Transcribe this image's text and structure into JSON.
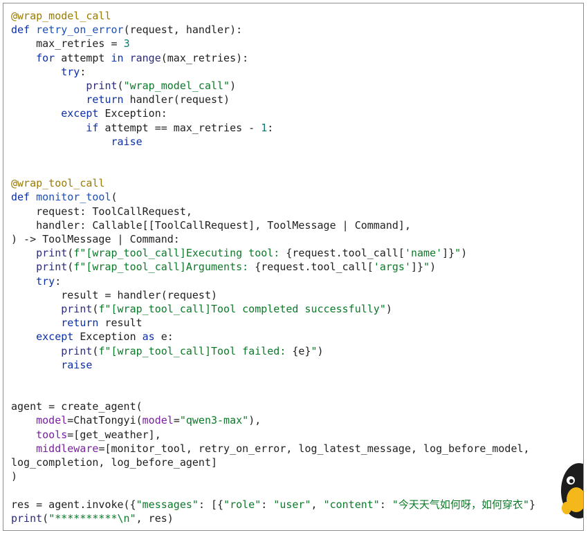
{
  "code_lines": [
    [
      {
        "t": "@wrap_model_call",
        "c": "dec"
      }
    ],
    [
      {
        "t": "def ",
        "c": "kw"
      },
      {
        "t": "retry_on_error",
        "c": "fn"
      },
      {
        "t": "(request, handler):",
        "c": "op"
      }
    ],
    [
      {
        "t": "    max_retries = ",
        "c": "op"
      },
      {
        "t": "3",
        "c": "num"
      }
    ],
    [
      {
        "t": "    ",
        "c": "op"
      },
      {
        "t": "for",
        "c": "kw"
      },
      {
        "t": " attempt ",
        "c": "op"
      },
      {
        "t": "in",
        "c": "kw"
      },
      {
        "t": " ",
        "c": "op"
      },
      {
        "t": "range",
        "c": "bi"
      },
      {
        "t": "(max_retries):",
        "c": "op"
      }
    ],
    [
      {
        "t": "        ",
        "c": "op"
      },
      {
        "t": "try",
        "c": "kw"
      },
      {
        "t": ":",
        "c": "op"
      }
    ],
    [
      {
        "t": "            ",
        "c": "op"
      },
      {
        "t": "print",
        "c": "bi"
      },
      {
        "t": "(",
        "c": "op"
      },
      {
        "t": "\"wrap_model_call\"",
        "c": "str"
      },
      {
        "t": ")",
        "c": "op"
      }
    ],
    [
      {
        "t": "            ",
        "c": "op"
      },
      {
        "t": "return",
        "c": "kw"
      },
      {
        "t": " handler(request)",
        "c": "op"
      }
    ],
    [
      {
        "t": "        ",
        "c": "op"
      },
      {
        "t": "except",
        "c": "kw"
      },
      {
        "t": " Exception:",
        "c": "op"
      }
    ],
    [
      {
        "t": "            ",
        "c": "op"
      },
      {
        "t": "if",
        "c": "kw"
      },
      {
        "t": " attempt == max_retries - ",
        "c": "op"
      },
      {
        "t": "1",
        "c": "num"
      },
      {
        "t": ":",
        "c": "op"
      }
    ],
    [
      {
        "t": "                ",
        "c": "op"
      },
      {
        "t": "raise",
        "c": "kw"
      }
    ],
    [],
    [],
    [
      {
        "t": "@wrap_tool_call",
        "c": "dec"
      }
    ],
    [
      {
        "t": "def ",
        "c": "kw"
      },
      {
        "t": "monitor_tool",
        "c": "fn"
      },
      {
        "t": "(",
        "c": "op"
      }
    ],
    [
      {
        "t": "    request: ToolCallRequest,",
        "c": "op"
      }
    ],
    [
      {
        "t": "    handler: Callable[[ToolCallRequest], ToolMessage | Command],",
        "c": "op"
      }
    ],
    [
      {
        "t": ") -> ToolMessage | Command:",
        "c": "op"
      }
    ],
    [
      {
        "t": "    ",
        "c": "op"
      },
      {
        "t": "print",
        "c": "bi"
      },
      {
        "t": "(",
        "c": "op"
      },
      {
        "t": "f\"[wrap_tool_call]Executing tool: ",
        "c": "str"
      },
      {
        "t": "{request.tool_call[",
        "c": "op"
      },
      {
        "t": "'name'",
        "c": "str"
      },
      {
        "t": "]}",
        "c": "op"
      },
      {
        "t": "\"",
        "c": "str"
      },
      {
        "t": ")",
        "c": "op"
      }
    ],
    [
      {
        "t": "    ",
        "c": "op"
      },
      {
        "t": "print",
        "c": "bi"
      },
      {
        "t": "(",
        "c": "op"
      },
      {
        "t": "f\"[wrap_tool_call]Arguments: ",
        "c": "str"
      },
      {
        "t": "{request.tool_call[",
        "c": "op"
      },
      {
        "t": "'args'",
        "c": "str"
      },
      {
        "t": "]}",
        "c": "op"
      },
      {
        "t": "\"",
        "c": "str"
      },
      {
        "t": ")",
        "c": "op"
      }
    ],
    [
      {
        "t": "    ",
        "c": "op"
      },
      {
        "t": "try",
        "c": "kw"
      },
      {
        "t": ":",
        "c": "op"
      }
    ],
    [
      {
        "t": "        result = handler(request)",
        "c": "op"
      }
    ],
    [
      {
        "t": "        ",
        "c": "op"
      },
      {
        "t": "print",
        "c": "bi"
      },
      {
        "t": "(",
        "c": "op"
      },
      {
        "t": "f\"[wrap_tool_call]Tool completed successfully\"",
        "c": "str"
      },
      {
        "t": ")",
        "c": "op"
      }
    ],
    [
      {
        "t": "        ",
        "c": "op"
      },
      {
        "t": "return",
        "c": "kw"
      },
      {
        "t": " result",
        "c": "op"
      }
    ],
    [
      {
        "t": "    ",
        "c": "op"
      },
      {
        "t": "except",
        "c": "kw"
      },
      {
        "t": " Exception ",
        "c": "op"
      },
      {
        "t": "as",
        "c": "kw"
      },
      {
        "t": " e:",
        "c": "op"
      }
    ],
    [
      {
        "t": "        ",
        "c": "op"
      },
      {
        "t": "print",
        "c": "bi"
      },
      {
        "t": "(",
        "c": "op"
      },
      {
        "t": "f\"[wrap_tool_call]Tool failed: ",
        "c": "str"
      },
      {
        "t": "{e}",
        "c": "op"
      },
      {
        "t": "\"",
        "c": "str"
      },
      {
        "t": ")",
        "c": "op"
      }
    ],
    [
      {
        "t": "        ",
        "c": "op"
      },
      {
        "t": "raise",
        "c": "kw"
      }
    ],
    [],
    [],
    [
      {
        "t": "agent = create_agent(",
        "c": "op"
      }
    ],
    [
      {
        "t": "    ",
        "c": "op"
      },
      {
        "t": "model",
        "c": "par"
      },
      {
        "t": "=ChatTongyi(",
        "c": "op"
      },
      {
        "t": "model",
        "c": "par"
      },
      {
        "t": "=",
        "c": "op"
      },
      {
        "t": "\"qwen3-max\"",
        "c": "str"
      },
      {
        "t": "),",
        "c": "op"
      }
    ],
    [
      {
        "t": "    ",
        "c": "op"
      },
      {
        "t": "tools",
        "c": "par"
      },
      {
        "t": "=[get_weather],",
        "c": "op"
      }
    ],
    [
      {
        "t": "    ",
        "c": "op"
      },
      {
        "t": "middleware",
        "c": "par"
      },
      {
        "t": "=[monitor_tool, retry_on_error, log_latest_message, log_before_model,",
        "c": "op"
      }
    ],
    [
      {
        "t": "log_completion, log_before_agent]",
        "c": "op"
      }
    ],
    [
      {
        "t": ")",
        "c": "op"
      }
    ],
    [],
    [
      {
        "t": "res = agent.invoke({",
        "c": "op"
      },
      {
        "t": "\"messages\"",
        "c": "str"
      },
      {
        "t": ": [{",
        "c": "op"
      },
      {
        "t": "\"role\"",
        "c": "str"
      },
      {
        "t": ": ",
        "c": "op"
      },
      {
        "t": "\"user\"",
        "c": "str"
      },
      {
        "t": ", ",
        "c": "op"
      },
      {
        "t": "\"content\"",
        "c": "str"
      },
      {
        "t": ": ",
        "c": "op"
      },
      {
        "t": "\"今天天气如何呀，如何穿衣\"",
        "c": "str"
      },
      {
        "t": "}",
        "c": "op"
      }
    ],
    [
      {
        "t": "print",
        "c": "bi"
      },
      {
        "t": "(",
        "c": "op"
      },
      {
        "t": "\"**********\\n\"",
        "c": "str"
      },
      {
        "t": ", res)",
        "c": "op"
      }
    ]
  ],
  "colors": {
    "decorator": "#9a7b00",
    "keyword": "#0b2fa8",
    "function_name": "#1c4fb5",
    "string": "#0b7a28",
    "number": "#0b7a6e",
    "parameter": "#7a1fa3",
    "text": "#1f1f1f",
    "border": "#8c8c8c",
    "background": "#ffffff"
  },
  "icons": {
    "mascot": "cartoon-mascot-icon"
  }
}
